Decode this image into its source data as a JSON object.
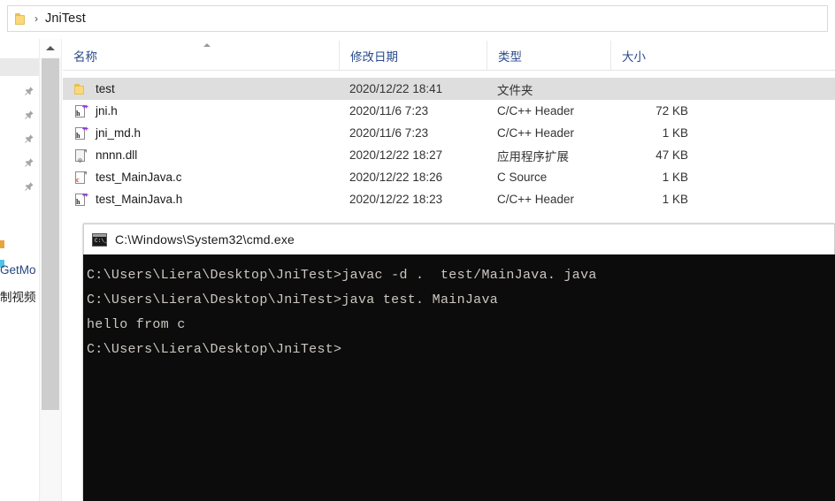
{
  "address_bar": {
    "folder_icon": "folder-icon",
    "separator": "›",
    "crumb": "JniTest"
  },
  "nav_pane": {
    "pin_icon": "pin-icon",
    "items": [
      {
        "label": "GetMo",
        "truncated": true
      },
      {
        "label": "制视频",
        "truncated": true
      }
    ],
    "scrollbar": {
      "up_arrow_icon": "chevron-up-icon"
    }
  },
  "file_list": {
    "columns": [
      {
        "key": "name",
        "label": "名称",
        "sorted": "asc"
      },
      {
        "key": "date",
        "label": "修改日期"
      },
      {
        "key": "type",
        "label": "类型"
      },
      {
        "key": "size",
        "label": "大小"
      }
    ],
    "rows": [
      {
        "icon": "folder-icon",
        "name": "test",
        "date": "2020/12/22 18:41",
        "type": "文件夹",
        "size": "",
        "selected": true
      },
      {
        "icon": "c-header-file-icon",
        "name": "jni.h",
        "date": "2020/11/6 7:23",
        "type": "C/C++ Header",
        "size": "72 KB",
        "selected": false
      },
      {
        "icon": "c-header-file-icon",
        "name": "jni_md.h",
        "date": "2020/11/6 7:23",
        "type": "C/C++ Header",
        "size": "1 KB",
        "selected": false
      },
      {
        "icon": "dll-file-icon",
        "name": "nnnn.dll",
        "date": "2020/12/22 18:27",
        "type": "应用程序扩展",
        "size": "47 KB",
        "selected": false
      },
      {
        "icon": "c-source-file-icon",
        "name": "test_MainJava.c",
        "date": "2020/12/22 18:26",
        "type": "C Source",
        "size": "1 KB",
        "selected": false
      },
      {
        "icon": "c-header-file-icon",
        "name": "test_MainJava.h",
        "date": "2020/12/22 18:23",
        "type": "C/C++ Header",
        "size": "1 KB",
        "selected": false
      }
    ]
  },
  "cmd_window": {
    "icon": "console-icon",
    "title": "C:\\Windows\\System32\\cmd.exe",
    "lines": [
      "C:\\Users\\Liera\\Desktop\\JniTest>javac -d .  test/MainJava. java",
      "",
      "C:\\Users\\Liera\\Desktop\\JniTest>java test. MainJava",
      "hello from c",
      "",
      "C:\\Users\\Liera\\Desktop\\JniTest>"
    ]
  },
  "colors": {
    "selection": "#dedede",
    "column_header_text": "#2a4b8d",
    "console_background": "#0c0c0c",
    "console_text": "#ccc8c0",
    "folder_yellow": "#fbd97a"
  }
}
